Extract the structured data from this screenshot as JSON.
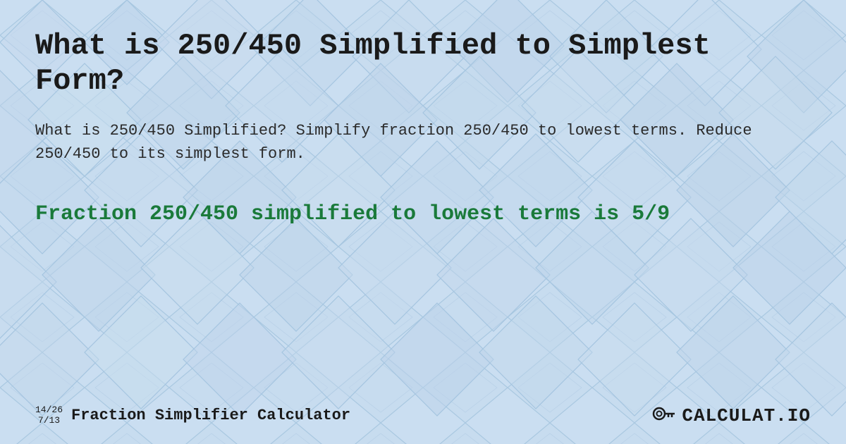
{
  "background": {
    "color": "#cfe0f0"
  },
  "main_title": "What is 250/450 Simplified to Simplest Form?",
  "description": "What is 250/450 Simplified? Simplify fraction 250/450 to lowest terms. Reduce 250/450 to its simplest form.",
  "result_heading": "Fraction 250/450 simplified to lowest terms is 5/9",
  "footer": {
    "fraction_top": "14/26",
    "fraction_bottom": "7/13",
    "site_label": "Fraction Simplifier Calculator",
    "brand": "CALCULAT.IO"
  }
}
